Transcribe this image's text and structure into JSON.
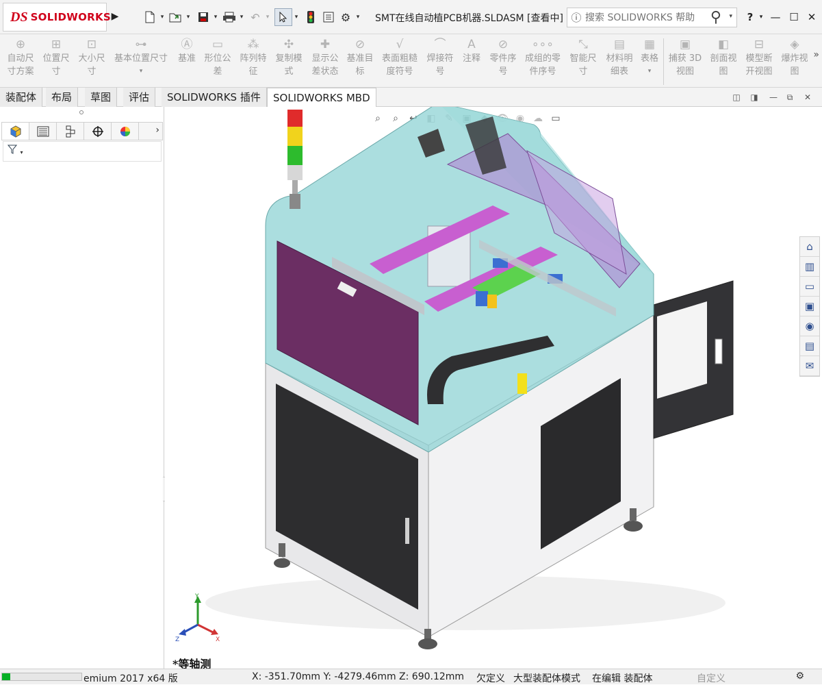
{
  "app": {
    "logo_prefix": "DS",
    "logo_name": "SOLIDWORKS",
    "document_title": "SMT在线自动植PCB机器.SLDASM [查看中]"
  },
  "quick_access": {
    "icons": [
      "expand-arrow-icon",
      "new-document-icon",
      "open-document-icon",
      "save-icon",
      "print-icon",
      "undo-icon",
      "select-arrow-icon",
      "rebuild-traffic-light-icon",
      "file-properties-icon",
      "options-gear-icon"
    ]
  },
  "search": {
    "placeholder": "搜索 SOLIDWORKS 帮助"
  },
  "window_controls": {
    "help": "?",
    "minimize": "—",
    "maximize": "☐",
    "close": "✕"
  },
  "ribbon": {
    "buttons": [
      {
        "label": "自动尺\n寸方案"
      },
      {
        "label": "位置尺\n寸"
      },
      {
        "label": "大小尺\n寸"
      },
      {
        "label": "基本位置尺寸"
      },
      {
        "label": "基准"
      },
      {
        "label": "形位公\n差"
      },
      {
        "label": "阵列特\n征"
      },
      {
        "label": "复制模\n式"
      },
      {
        "label": "显示公\n差状态"
      },
      {
        "label": "基准目\n标"
      },
      {
        "label": "表面粗糙\n度符号"
      },
      {
        "label": "焊接符\n号"
      },
      {
        "label": "注释"
      },
      {
        "label": "零件序\n号"
      },
      {
        "label": "成组的零\n件序号"
      },
      {
        "label": "智能尺\n寸"
      },
      {
        "label": "材料明\n细表"
      },
      {
        "label": "表格"
      },
      {
        "label": "捕获 3D\n视图"
      },
      {
        "label": "剖面视\n图"
      },
      {
        "label": "模型断\n开视图"
      },
      {
        "label": "爆炸视\n图"
      }
    ],
    "more": "»"
  },
  "tabs": [
    {
      "label": "装配体"
    },
    {
      "label": "布局"
    },
    {
      "label": "草图"
    },
    {
      "label": "评估"
    },
    {
      "label": "SOLIDWORKS 插件"
    },
    {
      "label": "SOLIDWORKS MBD"
    }
  ],
  "left_panel": {
    "tabs": [
      "feature-manager-icon",
      "property-manager-icon",
      "configuration-manager-icon",
      "dimxpert-icon",
      "display-manager-icon"
    ],
    "filter_icon": "filter-icon",
    "filter_text": "▼"
  },
  "viewport": {
    "view_name": "*等轴测",
    "triad": {
      "x": "X",
      "y": "Y",
      "z": "Z"
    }
  },
  "task_pane": {
    "icons": [
      "home-icon",
      "design-library-icon",
      "file-explorer-icon",
      "view-palette-icon",
      "appearances-icon",
      "custom-properties-icon",
      "forum-icon"
    ]
  },
  "status": {
    "progress": 0.1,
    "product": "emium 2017 x64 版",
    "coordinates": "X: -351.70mm Y: -4279.46mm Z: 690.12mm",
    "definition": "欠定义",
    "mode": "大型装配体模式",
    "editing": "在编辑 装配体",
    "units": "自定义"
  }
}
